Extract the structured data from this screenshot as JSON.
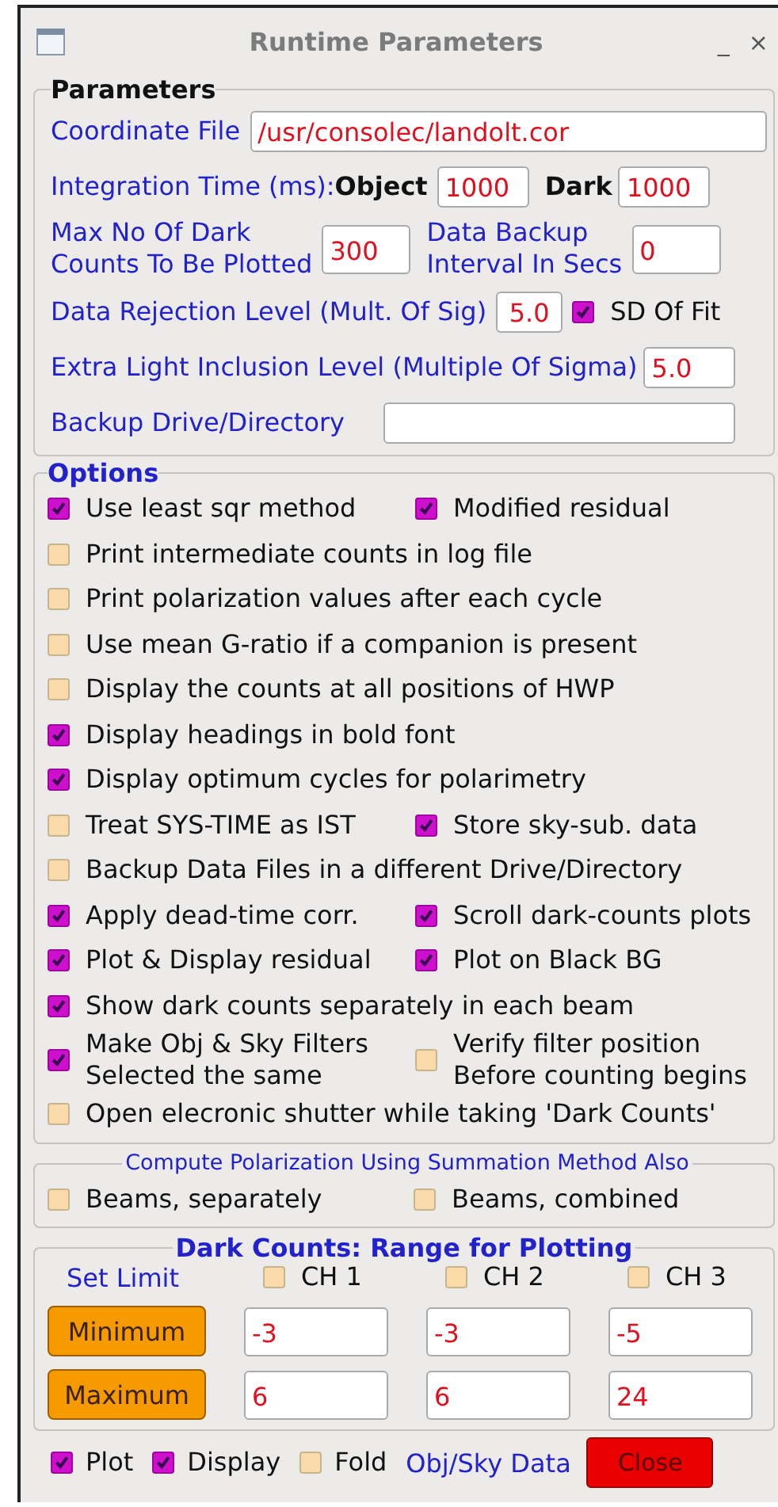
{
  "window": {
    "title": "Runtime Parameters",
    "minimize": "_",
    "close": "×"
  },
  "parameters": {
    "title": "Parameters",
    "coordinate_file": {
      "label": "Coordinate File",
      "value": "/usr/consolec/landolt.cor"
    },
    "integration_time": {
      "label": "Integration Time (ms):",
      "object_label": "Object",
      "object_value": "1000",
      "dark_label": "Dark",
      "dark_value": "1000"
    },
    "max_dark_counts": {
      "label": "Max No Of Dark\nCounts To Be Plotted",
      "value": "300"
    },
    "backup_interval": {
      "label": "Data Backup\nInterval In Secs",
      "value": "0"
    },
    "rejection_level": {
      "label": "Data Rejection Level (Mult. Of Sig)",
      "value": "5.0"
    },
    "sd_of_fit": {
      "label": "SD Of Fit",
      "checked": true
    },
    "extra_light": {
      "label": "Extra Light Inclusion Level (Multiple Of Sigma)",
      "value": "5.0"
    },
    "backup_directory": {
      "label": "Backup Drive/Directory"
    }
  },
  "options": {
    "title": "Options",
    "rows": [
      [
        {
          "label": "Use least sqr method",
          "checked": true
        },
        {
          "label": "Modified residual",
          "checked": true
        }
      ],
      [
        {
          "label": "Print intermediate counts in log file",
          "checked": false
        }
      ],
      [
        {
          "label": "Print polarization values after each cycle",
          "checked": false
        }
      ],
      [
        {
          "label": "Use mean G-ratio if a companion is present",
          "checked": false
        }
      ],
      [
        {
          "label": "Display the counts at all positions of HWP",
          "checked": false
        }
      ],
      [
        {
          "label": "Display headings in bold font",
          "checked": true
        }
      ],
      [
        {
          "label": "Display optimum cycles for polarimetry",
          "checked": true
        }
      ],
      [
        {
          "label": "Treat SYS-TIME as IST",
          "checked": false
        },
        {
          "label": "Store sky-sub. data",
          "checked": true
        }
      ],
      [
        {
          "label": "Backup Data Files in a different Drive/Directory",
          "checked": false
        }
      ],
      [
        {
          "label": "Apply dead-time corr.",
          "checked": true
        },
        {
          "label": "Scroll dark-counts plots",
          "checked": true
        }
      ],
      [
        {
          "label": "Plot & Display residual",
          "checked": true
        },
        {
          "label": "Plot on Black BG",
          "checked": true
        }
      ],
      [
        {
          "label": "Show dark counts separately in each beam",
          "checked": true
        }
      ],
      [
        {
          "label": "Make Obj & Sky Filters\nSelected the same",
          "checked": true
        },
        {
          "label": "Verify filter position\nBefore counting begins",
          "checked": false
        }
      ],
      [
        {
          "label": "Open elecronic shutter while taking 'Dark Counts'",
          "checked": false
        }
      ]
    ]
  },
  "summation": {
    "title": "Compute Polarization Using Summation Method Also",
    "items": [
      {
        "label": "Beams, separately",
        "checked": false
      },
      {
        "label": "Beams, combined",
        "checked": false
      }
    ]
  },
  "dark_counts": {
    "title": "Dark Counts: Range for Plotting",
    "set_limit": "Set Limit",
    "channels": [
      {
        "label": "CH 1",
        "checked": false
      },
      {
        "label": "CH 2",
        "checked": false
      },
      {
        "label": "CH 3",
        "checked": false
      }
    ],
    "rows": [
      {
        "button": "Minimum",
        "values": [
          "-3",
          "-3",
          "-5"
        ]
      },
      {
        "button": "Maximum",
        "values": [
          "6",
          "6",
          "24"
        ]
      }
    ]
  },
  "footer": {
    "items": [
      {
        "label": "Plot",
        "checked": true
      },
      {
        "label": "Display",
        "checked": true
      },
      {
        "label": "Fold",
        "checked": false
      }
    ],
    "caption": "Obj/Sky Data",
    "close": "Close"
  }
}
